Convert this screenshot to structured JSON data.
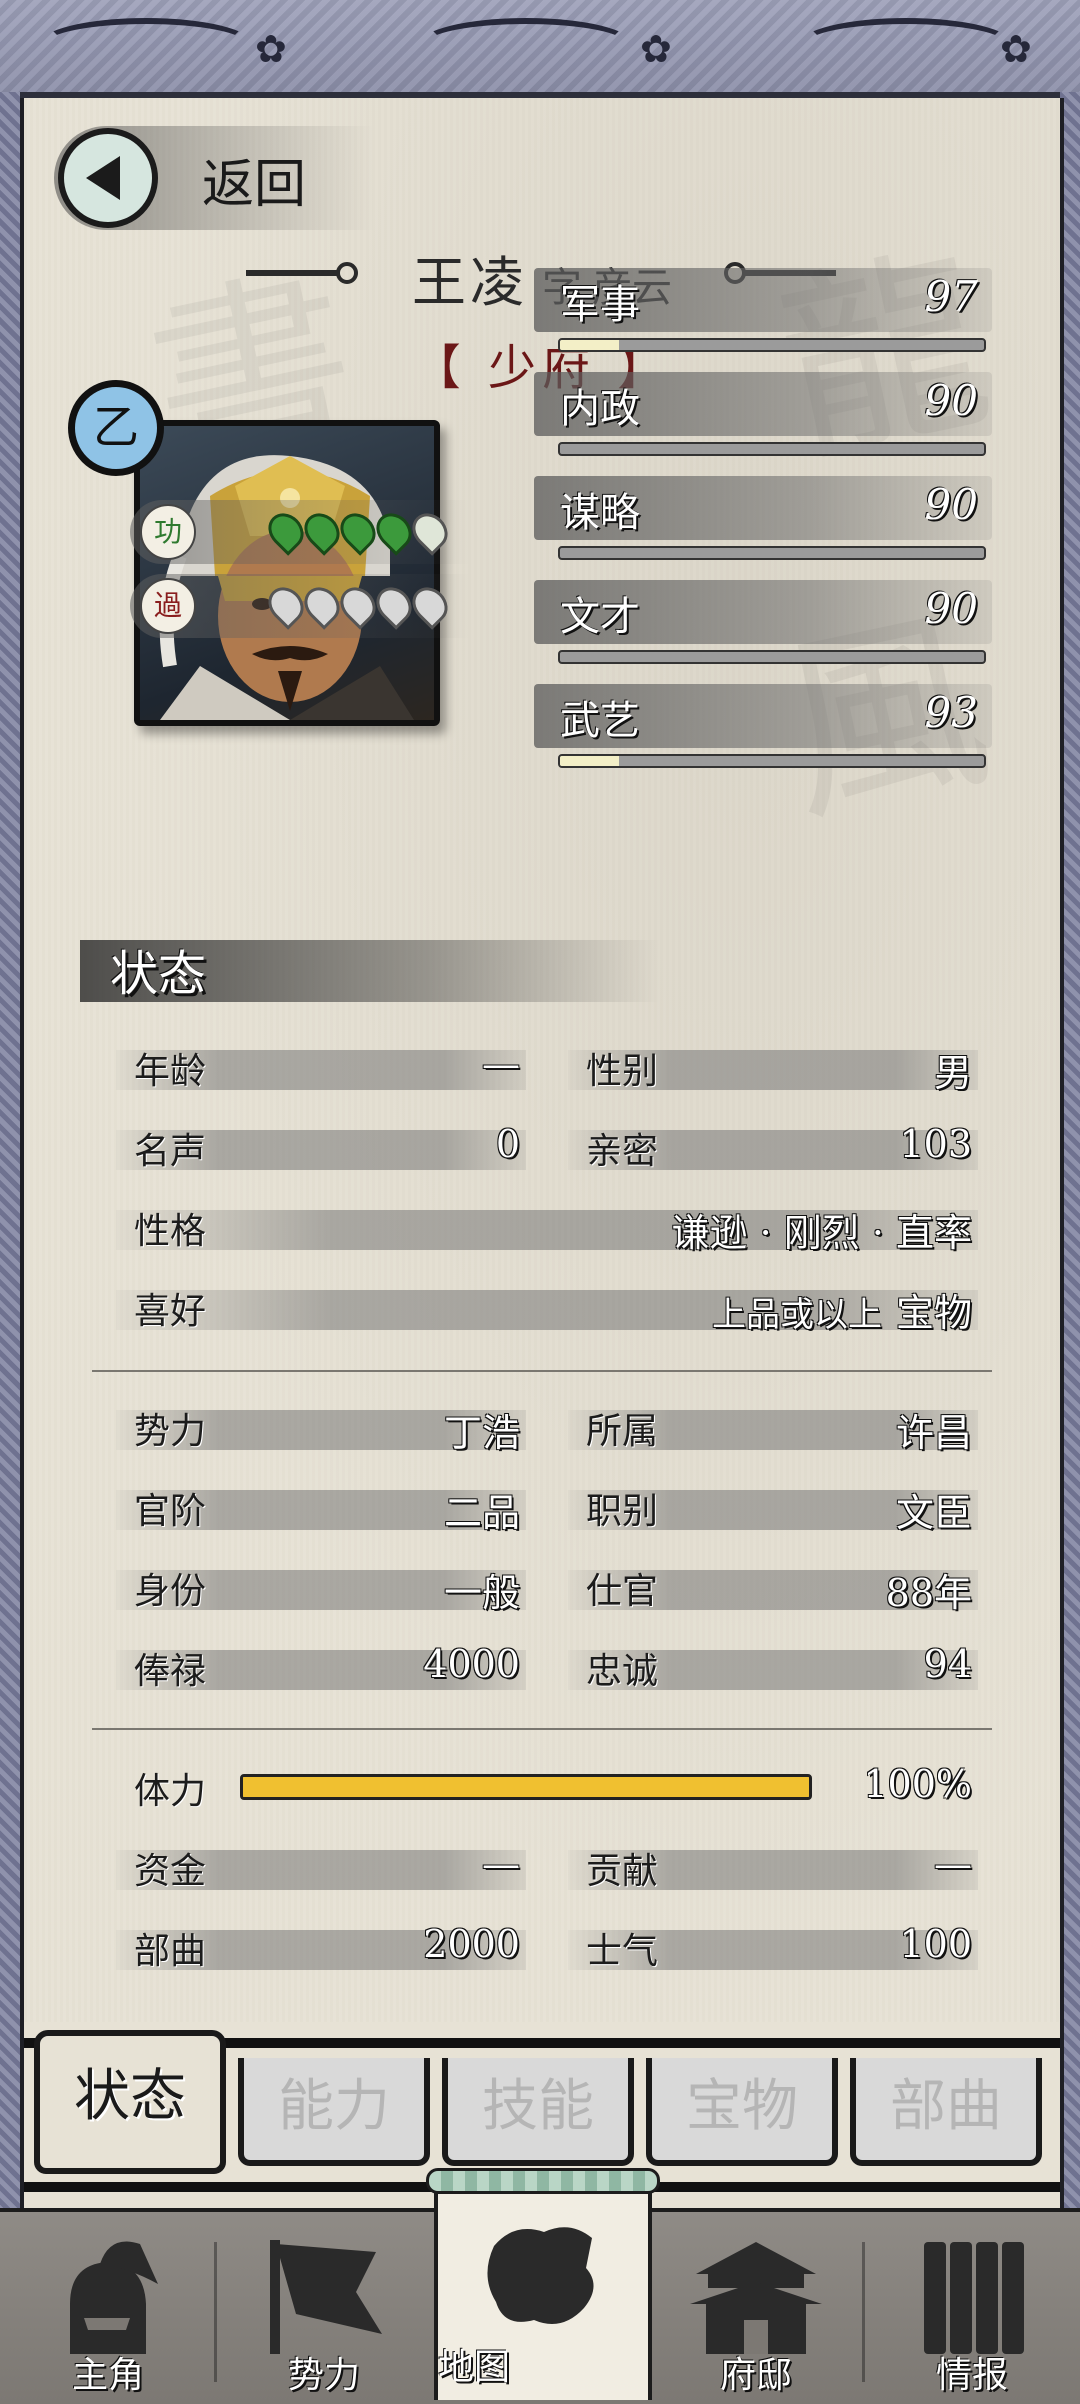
{
  "header": {
    "back_label": "返回",
    "name": "王凌",
    "zi_label": "字",
    "style_name": "彦云",
    "title": "【 少府 】",
    "grade": "乙"
  },
  "merit": {
    "merit_icon_text": "功",
    "fault_icon_text": "過",
    "merit_count": 4,
    "merit_max": 5,
    "fault_count": 0,
    "fault_max": 5
  },
  "stats": [
    {
      "label": "军事",
      "value": "97"
    },
    {
      "label": "内政",
      "value": "90"
    },
    {
      "label": "谋略",
      "value": "90"
    },
    {
      "label": "文才",
      "value": "90"
    },
    {
      "label": "武艺",
      "value": "93"
    }
  ],
  "stat_bar_fill": [
    0.14,
    0.0,
    0.0,
    0.0,
    0.14
  ],
  "status": {
    "title": "状态",
    "age_label": "年龄",
    "age_value": "—",
    "gender_label": "性别",
    "gender_value": "男",
    "fame_label": "名声",
    "fame_value": "0",
    "intimacy_label": "亲密",
    "intimacy_value": "103",
    "personality_label": "性格",
    "personality_value": "谦逊 · 刚烈 · 直率",
    "hobby_label": "喜好",
    "hobby_qualifier": "上品或以上",
    "hobby_value": "宝物",
    "faction_label": "势力",
    "faction_value": "丁浩",
    "belong_label": "所属",
    "belong_value": "许昌",
    "rank_label": "官阶",
    "rank_value": "二品",
    "role_label": "职别",
    "role_value": "文臣",
    "identity_label": "身份",
    "identity_value": "一般",
    "service_label": "仕官",
    "service_value": "88年",
    "salary_label": "俸禄",
    "salary_value": "4000",
    "loyalty_label": "忠诚",
    "loyalty_value": "94",
    "stamina_label": "体力",
    "stamina_value": "100%",
    "stamina_fraction": 1.0,
    "funds_label": "资金",
    "funds_value": "—",
    "contribution_label": "贡献",
    "contribution_value": "—",
    "troops_label": "部曲",
    "troops_value": "2000",
    "morale_label": "士气",
    "morale_value": "100"
  },
  "tabs": [
    "状态",
    "能力",
    "技能",
    "宝物",
    "部曲"
  ],
  "active_tab": 0,
  "bottom_nav": [
    "主角",
    "势力",
    "地图",
    "府邸",
    "情报"
  ],
  "active_nav": 2,
  "colors": {
    "title_red": "#6b1717",
    "grade_blue": "#8fc3e6",
    "stamina_yellow": "#f0c030",
    "merit_green": "#3c9a3c"
  }
}
